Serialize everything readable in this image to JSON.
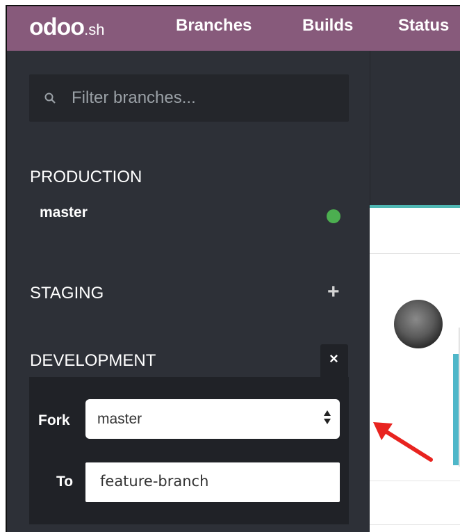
{
  "header": {
    "logo_main": "odoo",
    "logo_suffix": ".sh",
    "nav": [
      "Branches",
      "Builds",
      "Status"
    ],
    "background_color": "#875a7b"
  },
  "sidebar": {
    "search_placeholder": "Filter branches...",
    "sections": {
      "production": {
        "title": "PRODUCTION",
        "branches": [
          {
            "name": "master",
            "status_color": "#4caf50"
          }
        ]
      },
      "staging": {
        "title": "STAGING",
        "action_icon": "plus-icon"
      },
      "development": {
        "title": "DEVELOPMENT",
        "action_icon": "close-icon",
        "fork_form": {
          "fork_label": "Fork",
          "fork_value": "master",
          "to_label": "To",
          "to_value": "feature-branch"
        }
      }
    }
  },
  "annotations": {
    "arrow_color": "#e8231f"
  },
  "theme": {
    "sidebar_bg": "#2d3037",
    "accent_teal": "#4fb7b3"
  }
}
